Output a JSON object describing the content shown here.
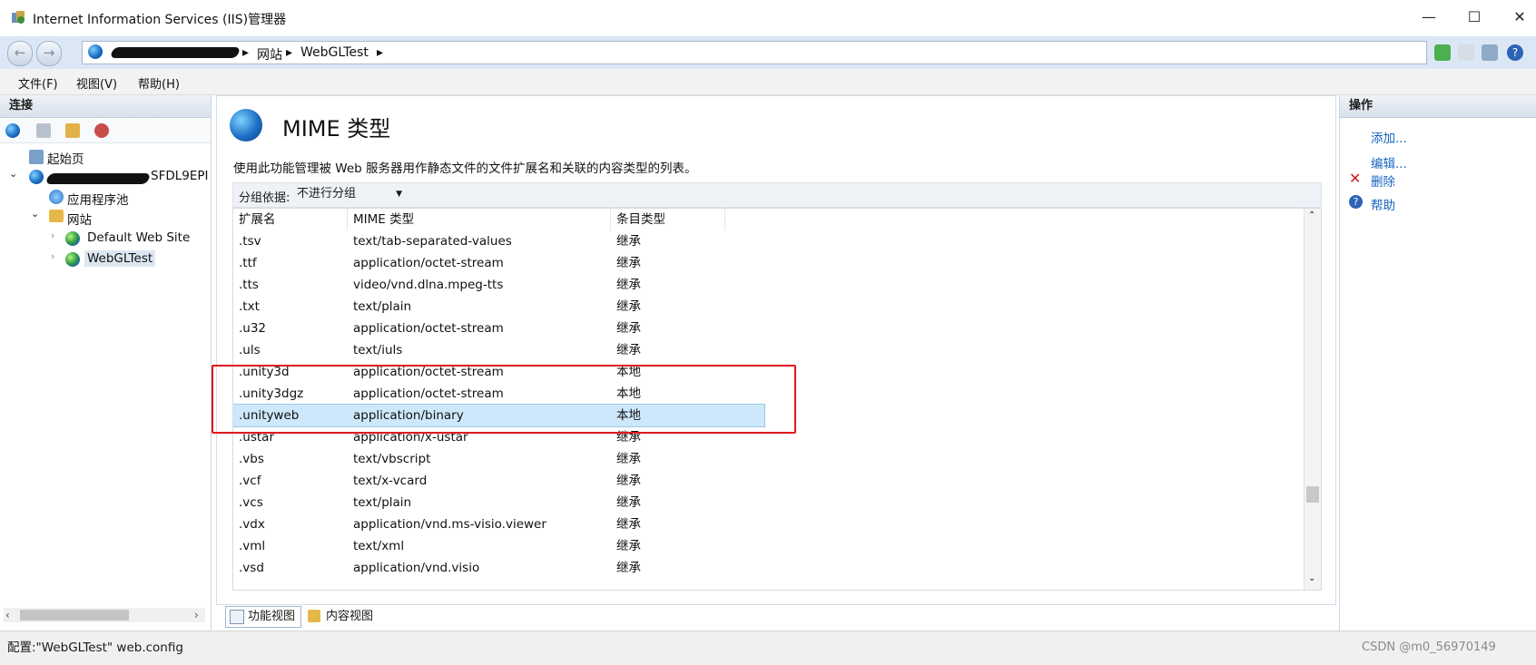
{
  "window": {
    "title": "Internet Information Services (IIS)管理器",
    "minimize": "—",
    "maximize": "☐",
    "close": "✕"
  },
  "address": {
    "crumbs": [
      "网站",
      "WebGLTest"
    ],
    "separator": "▸"
  },
  "menu": {
    "items": [
      "文件(F)",
      "视图(V)",
      "帮助(H)"
    ]
  },
  "connections": {
    "header": "连接",
    "tree": {
      "start_page": "起始页",
      "server_suffix": "SFDL9EPI",
      "app_pools": "应用程序池",
      "sites": "网站",
      "site1": "Default Web Site",
      "site2": "WebGLTest"
    }
  },
  "feature": {
    "title": "MIME 类型",
    "description": "使用此功能管理被 Web 服务器用作静态文件的文件扩展名和关联的内容类型的列表。",
    "group_label": "分组依据:",
    "group_value": "不进行分组",
    "columns": [
      "扩展名",
      "MIME 类型",
      "条目类型"
    ],
    "rows": [
      {
        "ext": ".tsv",
        "mime": "text/tab-separated-values",
        "type": "继承"
      },
      {
        "ext": ".ttf",
        "mime": "application/octet-stream",
        "type": "继承"
      },
      {
        "ext": ".tts",
        "mime": "video/vnd.dlna.mpeg-tts",
        "type": "继承"
      },
      {
        "ext": ".txt",
        "mime": "text/plain",
        "type": "继承"
      },
      {
        "ext": ".u32",
        "mime": "application/octet-stream",
        "type": "继承"
      },
      {
        "ext": ".uls",
        "mime": "text/iuls",
        "type": "继承"
      },
      {
        "ext": ".unity3d",
        "mime": "application/octet-stream",
        "type": "本地"
      },
      {
        "ext": ".unity3dgz",
        "mime": "application/octet-stream",
        "type": "本地"
      },
      {
        "ext": ".unityweb",
        "mime": "application/binary",
        "type": "本地"
      },
      {
        "ext": ".ustar",
        "mime": "application/x-ustar",
        "type": "继承"
      },
      {
        "ext": ".vbs",
        "mime": "text/vbscript",
        "type": "继承"
      },
      {
        "ext": ".vcf",
        "mime": "text/x-vcard",
        "type": "继承"
      },
      {
        "ext": ".vcs",
        "mime": "text/plain",
        "type": "继承"
      },
      {
        "ext": ".vdx",
        "mime": "application/vnd.ms-visio.viewer",
        "type": "继承"
      },
      {
        "ext": ".vml",
        "mime": "text/xml",
        "type": "继承"
      },
      {
        "ext": ".vsd",
        "mime": "application/vnd.visio",
        "type": "继承"
      }
    ],
    "selected_row": 8
  },
  "view_tabs": [
    "功能视图",
    "内容视图"
  ],
  "actions": {
    "header": "操作",
    "add": "添加...",
    "edit": "编辑...",
    "delete": "删除",
    "help": "帮助"
  },
  "status": {
    "text": "配置:\"WebGLTest\" web.config",
    "watermark": "CSDN @m0_56970149"
  }
}
